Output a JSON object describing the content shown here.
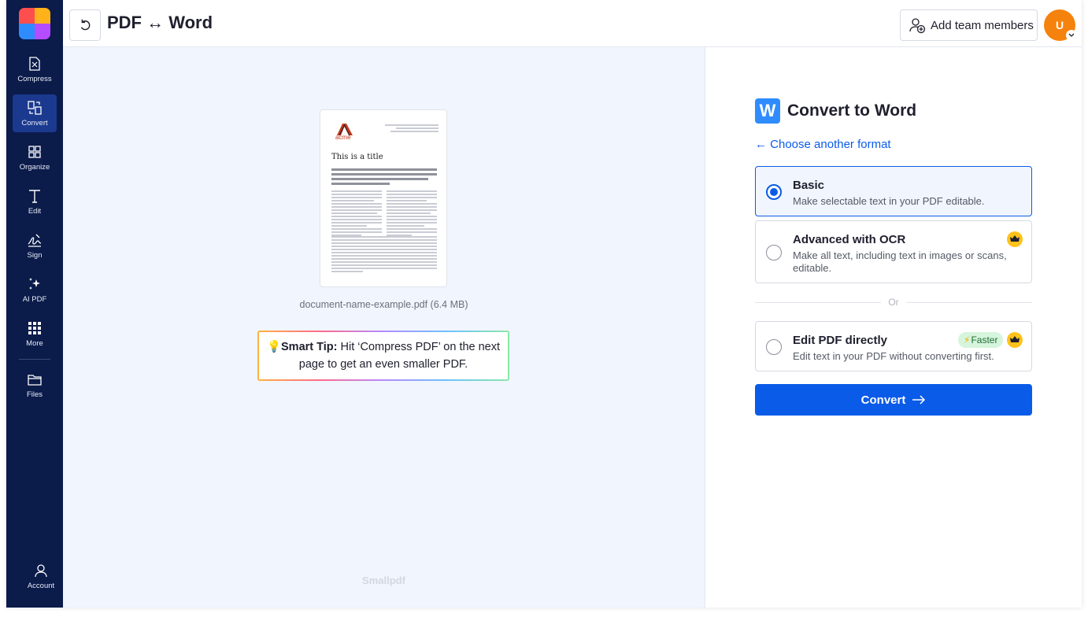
{
  "sidebar": {
    "items": [
      {
        "label": "Compress",
        "icon": "compress-icon"
      },
      {
        "label": "Convert",
        "icon": "convert-icon",
        "active": true
      },
      {
        "label": "Organize",
        "icon": "organize-icon"
      },
      {
        "label": "Edit",
        "icon": "edit-text-icon"
      },
      {
        "label": "Sign",
        "icon": "sign-icon"
      },
      {
        "label": "AI PDF",
        "icon": "ai-sparkle-icon"
      },
      {
        "label": "More",
        "icon": "grid-more-icon"
      }
    ],
    "files_label": "Files",
    "account_label": "Account"
  },
  "header": {
    "title": "PDF ↔ Word",
    "team_button": "Add team members",
    "avatar_initial": "U"
  },
  "preview": {
    "doc_logo_text": "acme",
    "doc_title": "This is a title",
    "filename": "document-name-example.pdf (6.4 MB)",
    "tip_bold": "Smart Tip:",
    "tip_text": " Hit ‘Compress PDF’ on the next page to get an even smaller PDF.",
    "watermark": "Smallpdf"
  },
  "panel": {
    "title": "Convert to Word",
    "word_icon_letter": "W",
    "choose_link": "← Choose another format",
    "options": [
      {
        "title": "Basic",
        "desc": "Make selectable text in your PDF editable.",
        "selected": true
      },
      {
        "title": "Advanced with OCR",
        "desc": "Make all text, including text in images or scans, editable.",
        "selected": false,
        "premium": true
      },
      {
        "title": "Edit PDF directly",
        "desc": "Edit text in your PDF without converting first.",
        "selected": false,
        "premium": true,
        "badge": "Faster"
      }
    ],
    "or_label": "Or",
    "convert_button": "Convert"
  },
  "colors": {
    "sidebar_bg": "#0b1b4a",
    "accent": "#0a5be8",
    "avatar": "#f5820d",
    "crown": "#ffc21a"
  }
}
